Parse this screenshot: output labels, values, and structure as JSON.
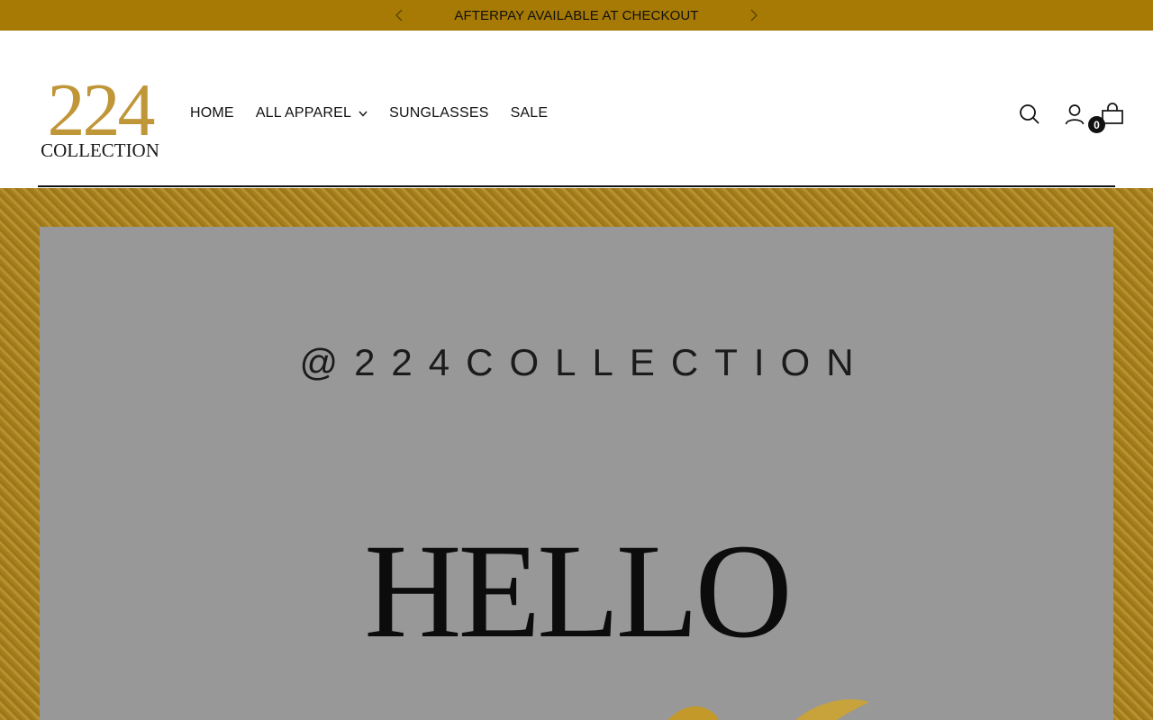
{
  "announcement": {
    "text": "AFTERPAY AVAILABLE AT CHECKOUT",
    "prev_icon": "chevron-left-icon",
    "next_icon": "chevron-right-icon",
    "background_color": "#a67a04"
  },
  "logo": {
    "number": "224",
    "word": "COLLECTION",
    "number_color": "#bf9638"
  },
  "nav": {
    "items": [
      {
        "label": "HOME",
        "has_dropdown": false
      },
      {
        "label": "ALL APPAREL",
        "has_dropdown": true
      },
      {
        "label": "SUNGLASSES",
        "has_dropdown": false
      },
      {
        "label": "SALE",
        "has_dropdown": false
      }
    ]
  },
  "header_icons": {
    "search": "search-icon",
    "account": "account-icon",
    "cart": "cart-icon",
    "cart_count": "0"
  },
  "hero": {
    "handle": "@224COLLECTION",
    "title": "HELLO",
    "frame_color": "#b08a28",
    "card_color": "#989898"
  }
}
